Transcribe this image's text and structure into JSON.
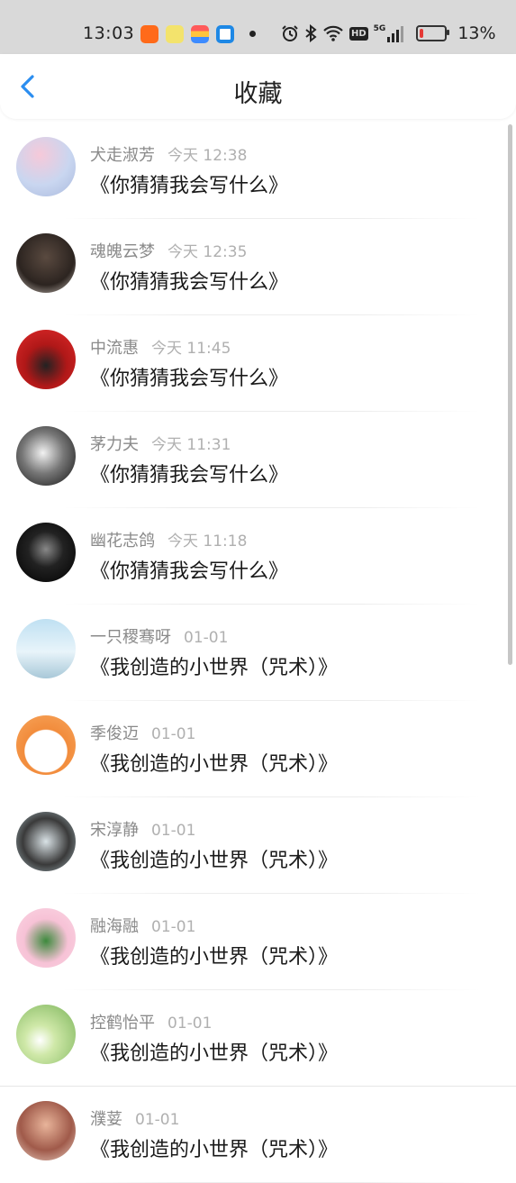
{
  "status_bar": {
    "time": "13:03",
    "network": "5G",
    "hd": "HD",
    "battery_percent": "13%",
    "battery_level": 0.13,
    "app_icons": [
      "taobao-icon",
      "chat-app-icon",
      "gallery-icon",
      "browser-icon"
    ],
    "indicators": [
      "alarm-icon",
      "bluetooth-icon",
      "wifi-icon",
      "hd-icon",
      "signal-icon",
      "battery-icon"
    ]
  },
  "header": {
    "title": "收藏",
    "back_icon": "chevron-left-icon"
  },
  "colors": {
    "accent": "#2b8ef0",
    "name": "#8a8a8a",
    "time": "#b0b0b0",
    "title": "#1a1a1a",
    "status_bg": "#d9d9d9"
  },
  "items": [
    {
      "name": "犬走淑芳",
      "time": "今天 12:38",
      "title": "《你猜猜我会写什么》"
    },
    {
      "name": "魂魄云梦",
      "time": "今天 12:35",
      "title": "《你猜猜我会写什么》"
    },
    {
      "name": "中流惠",
      "time": "今天 11:45",
      "title": "《你猜猜我会写什么》"
    },
    {
      "name": "茅力夫",
      "time": "今天 11:31",
      "title": "《你猜猜我会写什么》"
    },
    {
      "name": "幽花志鸽",
      "time": "今天 11:18",
      "title": "《你猜猜我会写什么》"
    },
    {
      "name": "一只稷骞呀",
      "time": "01-01",
      "title": "《我创造的小世界（咒术）》"
    },
    {
      "name": "季俊迈",
      "time": "01-01",
      "title": "《我创造的小世界（咒术）》"
    },
    {
      "name": "宋淳静",
      "time": "01-01",
      "title": "《我创造的小世界（咒术）》"
    },
    {
      "name": "融海融",
      "time": "01-01",
      "title": "《我创造的小世界（咒术）》"
    },
    {
      "name": "控鹤怡平",
      "time": "01-01",
      "title": "《我创造的小世界（咒术）》"
    },
    {
      "name": "濮荽",
      "time": "01-01",
      "title": "《我创造的小世界（咒术）》"
    }
  ]
}
